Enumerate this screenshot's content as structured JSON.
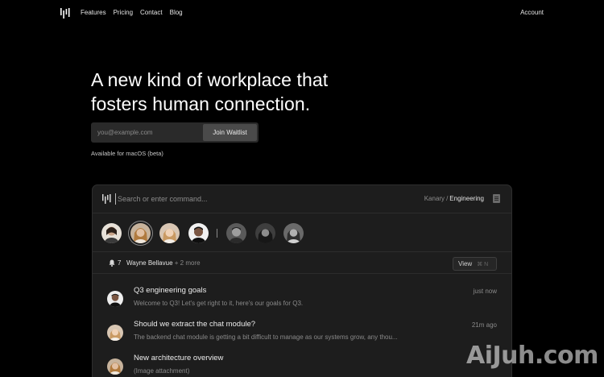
{
  "nav": {
    "links": [
      "Features",
      "Pricing",
      "Contact",
      "Blog"
    ],
    "account": "Account"
  },
  "hero": {
    "title": "A new kind of workplace that fosters human connection.",
    "email_placeholder": "you@example.com",
    "join_label": "Join Waitlist",
    "availability": "Available for macOS (beta)"
  },
  "app": {
    "command_placeholder": "Search or enter command...",
    "workspace": "Kanary",
    "breadcrumb_sep": "/",
    "team": "Engineering",
    "thread": {
      "count": "7",
      "primary_name": "Wayne Bellavue",
      "more": "+ 2 more",
      "view_label": "View",
      "view_shortcut": "⌘ N"
    },
    "messages": [
      {
        "title": "Q3 engineering goals",
        "preview": "Welcome to Q3! Let's get right to it, here's our goals for Q3.",
        "time": "just now"
      },
      {
        "title": "Should we extract the chat module?",
        "preview": "The backend chat module is getting a bit difficult to manage as our systems grow, any thou...",
        "time": "21m ago"
      },
      {
        "title": "New architecture overview",
        "preview": "(Image attachment)",
        "time": ""
      }
    ]
  },
  "watermark": "AiJuh.com",
  "colors": {
    "background": "#000000",
    "panel": "#1d1d1d",
    "muted_text": "#8a8a8a",
    "button": "#4a4a4a"
  }
}
